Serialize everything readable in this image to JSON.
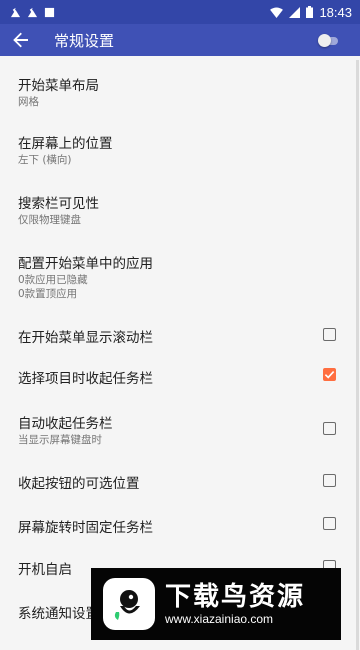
{
  "status_bar": {
    "time": "18:43",
    "icons": [
      "notification-icon",
      "notification-icon",
      "notification-icon",
      "wifi-icon",
      "signal-icon",
      "battery-icon"
    ]
  },
  "toolbar": {
    "title": "常规设置",
    "back_icon": "arrow-back-icon",
    "switch_state": "off"
  },
  "settings": {
    "start_menu_layout": {
      "title": "开始菜单布局",
      "summary": "网格"
    },
    "screen_position": {
      "title": "在屏幕上的位置",
      "summary": "左下 (横向)"
    },
    "search_bar_visibility": {
      "title": "搜索栏可见性",
      "summary": "仅限物理键盘"
    },
    "configure_apps": {
      "title": "配置开始菜单中的应用",
      "summary_line1": "0款应用已隐藏",
      "summary_line2": "0款置顶应用"
    },
    "show_scrollbar": {
      "title": "在开始菜单显示滚动栏",
      "checked": false
    },
    "collapse_on_select": {
      "title": "选择项目时收起任务栏",
      "checked": true
    },
    "auto_collapse": {
      "title": "自动收起任务栏",
      "summary": "当显示屏幕键盘时",
      "checked": false
    },
    "collapse_button_position": {
      "title": "收起按钮的可选位置",
      "checked": false
    },
    "fix_on_rotation": {
      "title": "屏幕旋转时固定任务栏",
      "checked": false
    },
    "start_on_boot": {
      "title": "开机自启",
      "checked": false
    },
    "notification_settings": {
      "title": "系统通知设置"
    }
  },
  "colors": {
    "status_bar": "#3346a8",
    "toolbar": "#3f51b5",
    "accent": "#ff6e40",
    "background": "#f5f5f5"
  },
  "watermark": {
    "title": "下载鸟资源",
    "url": "www.xiazainiao.com"
  }
}
